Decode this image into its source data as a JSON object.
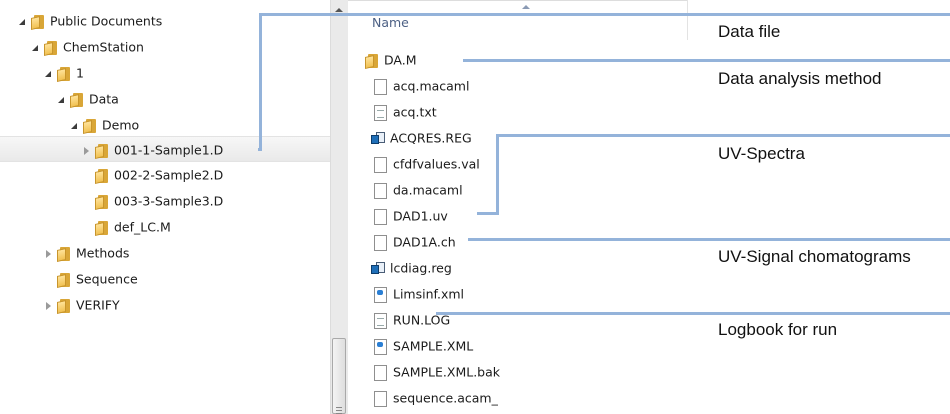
{
  "tree": [
    {
      "label": "Public Documents",
      "expander": "open"
    },
    {
      "label": "ChemStation",
      "expander": "open"
    },
    {
      "label": "1",
      "expander": "open"
    },
    {
      "label": "Data",
      "expander": "open"
    },
    {
      "label": "Demo",
      "expander": "open"
    },
    {
      "label": "001-1-Sample1.D",
      "expander": "closed",
      "selected": true
    },
    {
      "label": "002-2-Sample2.D",
      "expander": "none"
    },
    {
      "label": "003-3-Sample3.D",
      "expander": "none"
    },
    {
      "label": "def_LC.M",
      "expander": "none"
    },
    {
      "label": "Methods",
      "expander": "closed"
    },
    {
      "label": "Sequence",
      "expander": "none"
    },
    {
      "label": "VERIFY",
      "expander": "closed"
    }
  ],
  "file_list": {
    "column_header": "Name",
    "files": [
      {
        "name": "DA.M",
        "icon": "folder-icon"
      },
      {
        "name": "acq.macaml",
        "icon": "document-icon"
      },
      {
        "name": "acq.txt",
        "icon": "text-document-icon"
      },
      {
        "name": "ACQRES.REG",
        "icon": "registry-icon"
      },
      {
        "name": "cfdfvalues.val",
        "icon": "document-icon"
      },
      {
        "name": "da.macaml",
        "icon": "document-icon"
      },
      {
        "name": "DAD1.uv",
        "icon": "document-icon"
      },
      {
        "name": "DAD1A.ch",
        "icon": "document-icon"
      },
      {
        "name": "lcdiag.reg",
        "icon": "registry-icon"
      },
      {
        "name": "Limsinf.xml",
        "icon": "xml-document-icon"
      },
      {
        "name": "RUN.LOG",
        "icon": "text-document-icon"
      },
      {
        "name": "SAMPLE.XML",
        "icon": "xml-document-icon"
      },
      {
        "name": "SAMPLE.XML.bak",
        "icon": "document-icon"
      },
      {
        "name": "sequence.acam_",
        "icon": "document-icon"
      }
    ]
  },
  "callouts": [
    {
      "text": "Data file"
    },
    {
      "text": "Data analysis method"
    },
    {
      "text": "UV-Spectra"
    },
    {
      "text": "UV-Signal chomatograms"
    },
    {
      "text": "Logbook for run"
    }
  ],
  "colors": {
    "callout_line": "#94b3da",
    "header_text": "#4d6185"
  }
}
